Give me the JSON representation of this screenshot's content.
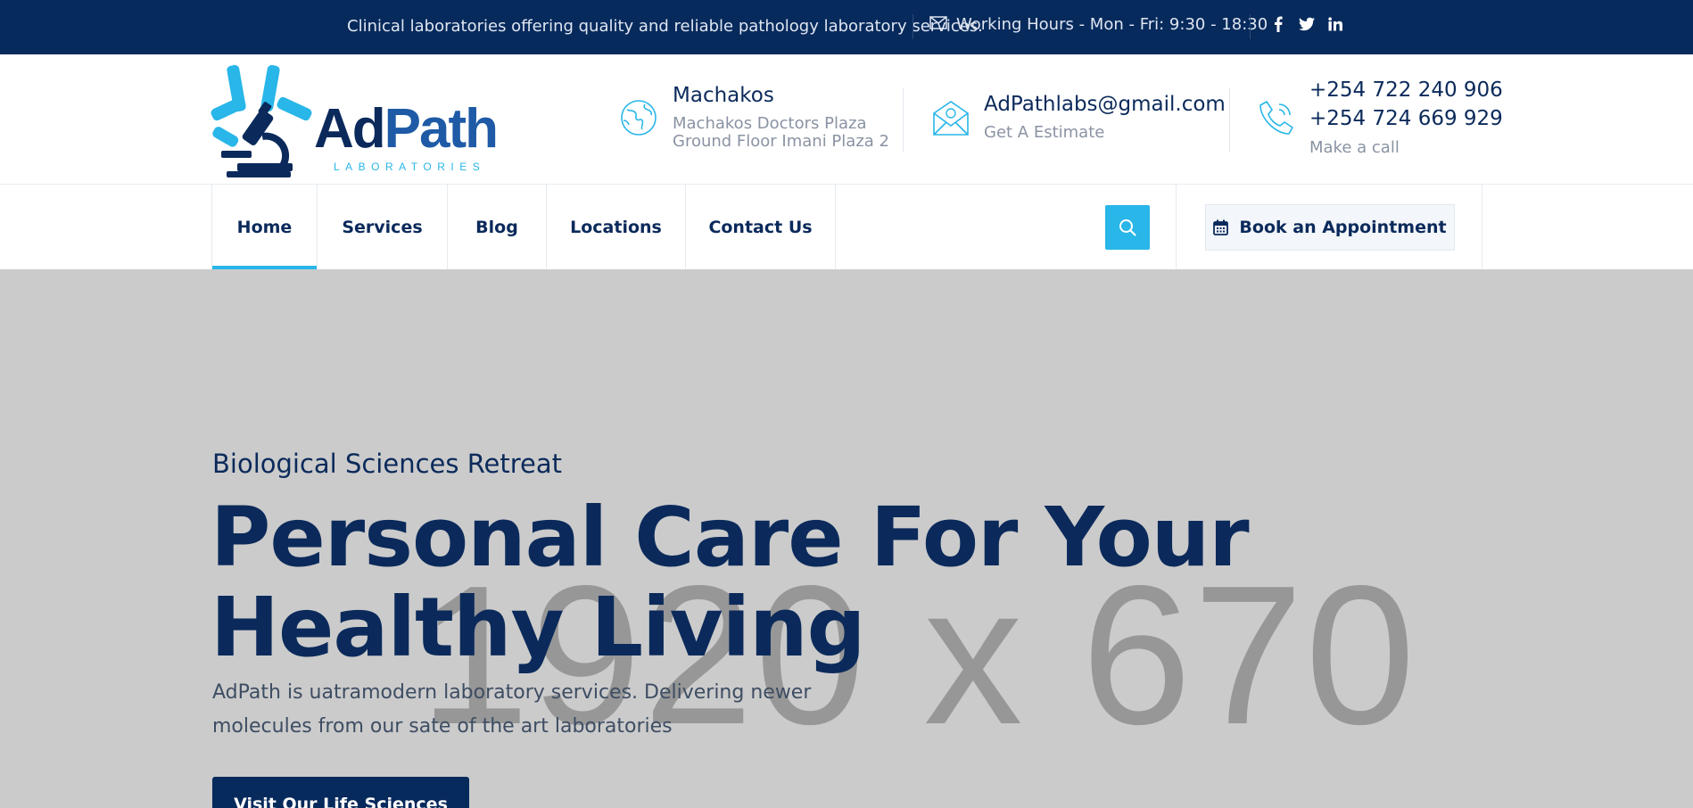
{
  "topbar": {
    "tagline": "Clinical laboratories offering quality and reliable pathology laboratory services.",
    "hours": "Working Hours - Mon - Fri: 9:30 - 18:30",
    "social": [
      "facebook-icon",
      "twitter-icon",
      "linkedin-icon"
    ]
  },
  "logo": {
    "word_a": "Ad",
    "word_b": "Path",
    "sub": "LABORATORIES"
  },
  "contact": {
    "location": {
      "title": "Machakos",
      "line1": "Machakos Doctors Plaza",
      "line2": "Ground Floor Imani Plaza 2",
      "icon": "globe-icon"
    },
    "email": {
      "title": "AdPathlabs@gmail.com",
      "sub": "Get A Estimate",
      "icon": "envelope-icon"
    },
    "phone": {
      "line1": "+254 722 240 906",
      "line2": "+254 724 669 929",
      "sub": "Make a call",
      "icon": "phone-icon"
    }
  },
  "nav": {
    "items": [
      {
        "label": "Home",
        "active": true
      },
      {
        "label": "Services"
      },
      {
        "label": "Blog"
      },
      {
        "label": "Locations"
      },
      {
        "label": "Contact Us"
      }
    ],
    "book_label": "Book an Appointment"
  },
  "hero": {
    "placeholder": "1920 x 670",
    "pretitle": "Biological Sciences Retreat",
    "title_line1": "Personal Care For Your",
    "title_line2": "Healthy Living",
    "description": "AdPath is uatramodern laboratory services. Delivering newer molecules from our sate of the art laboratories",
    "cta": "Visit Our Life Sciences"
  },
  "colors": {
    "navy": "#072a5c",
    "accent": "#29b6e8",
    "hero_bg": "#cbcbcb"
  }
}
